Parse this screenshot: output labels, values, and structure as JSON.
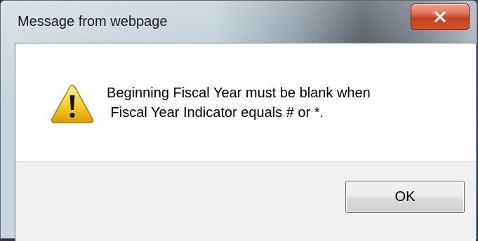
{
  "dialog": {
    "title": "Message from webpage",
    "icon": "warning-icon",
    "message_lines": [
      "Beginning Fiscal Year must be blank when",
      " Fiscal Year Indicator equals # or *."
    ],
    "ok_label": "OK",
    "close_icon": "close-icon"
  }
}
